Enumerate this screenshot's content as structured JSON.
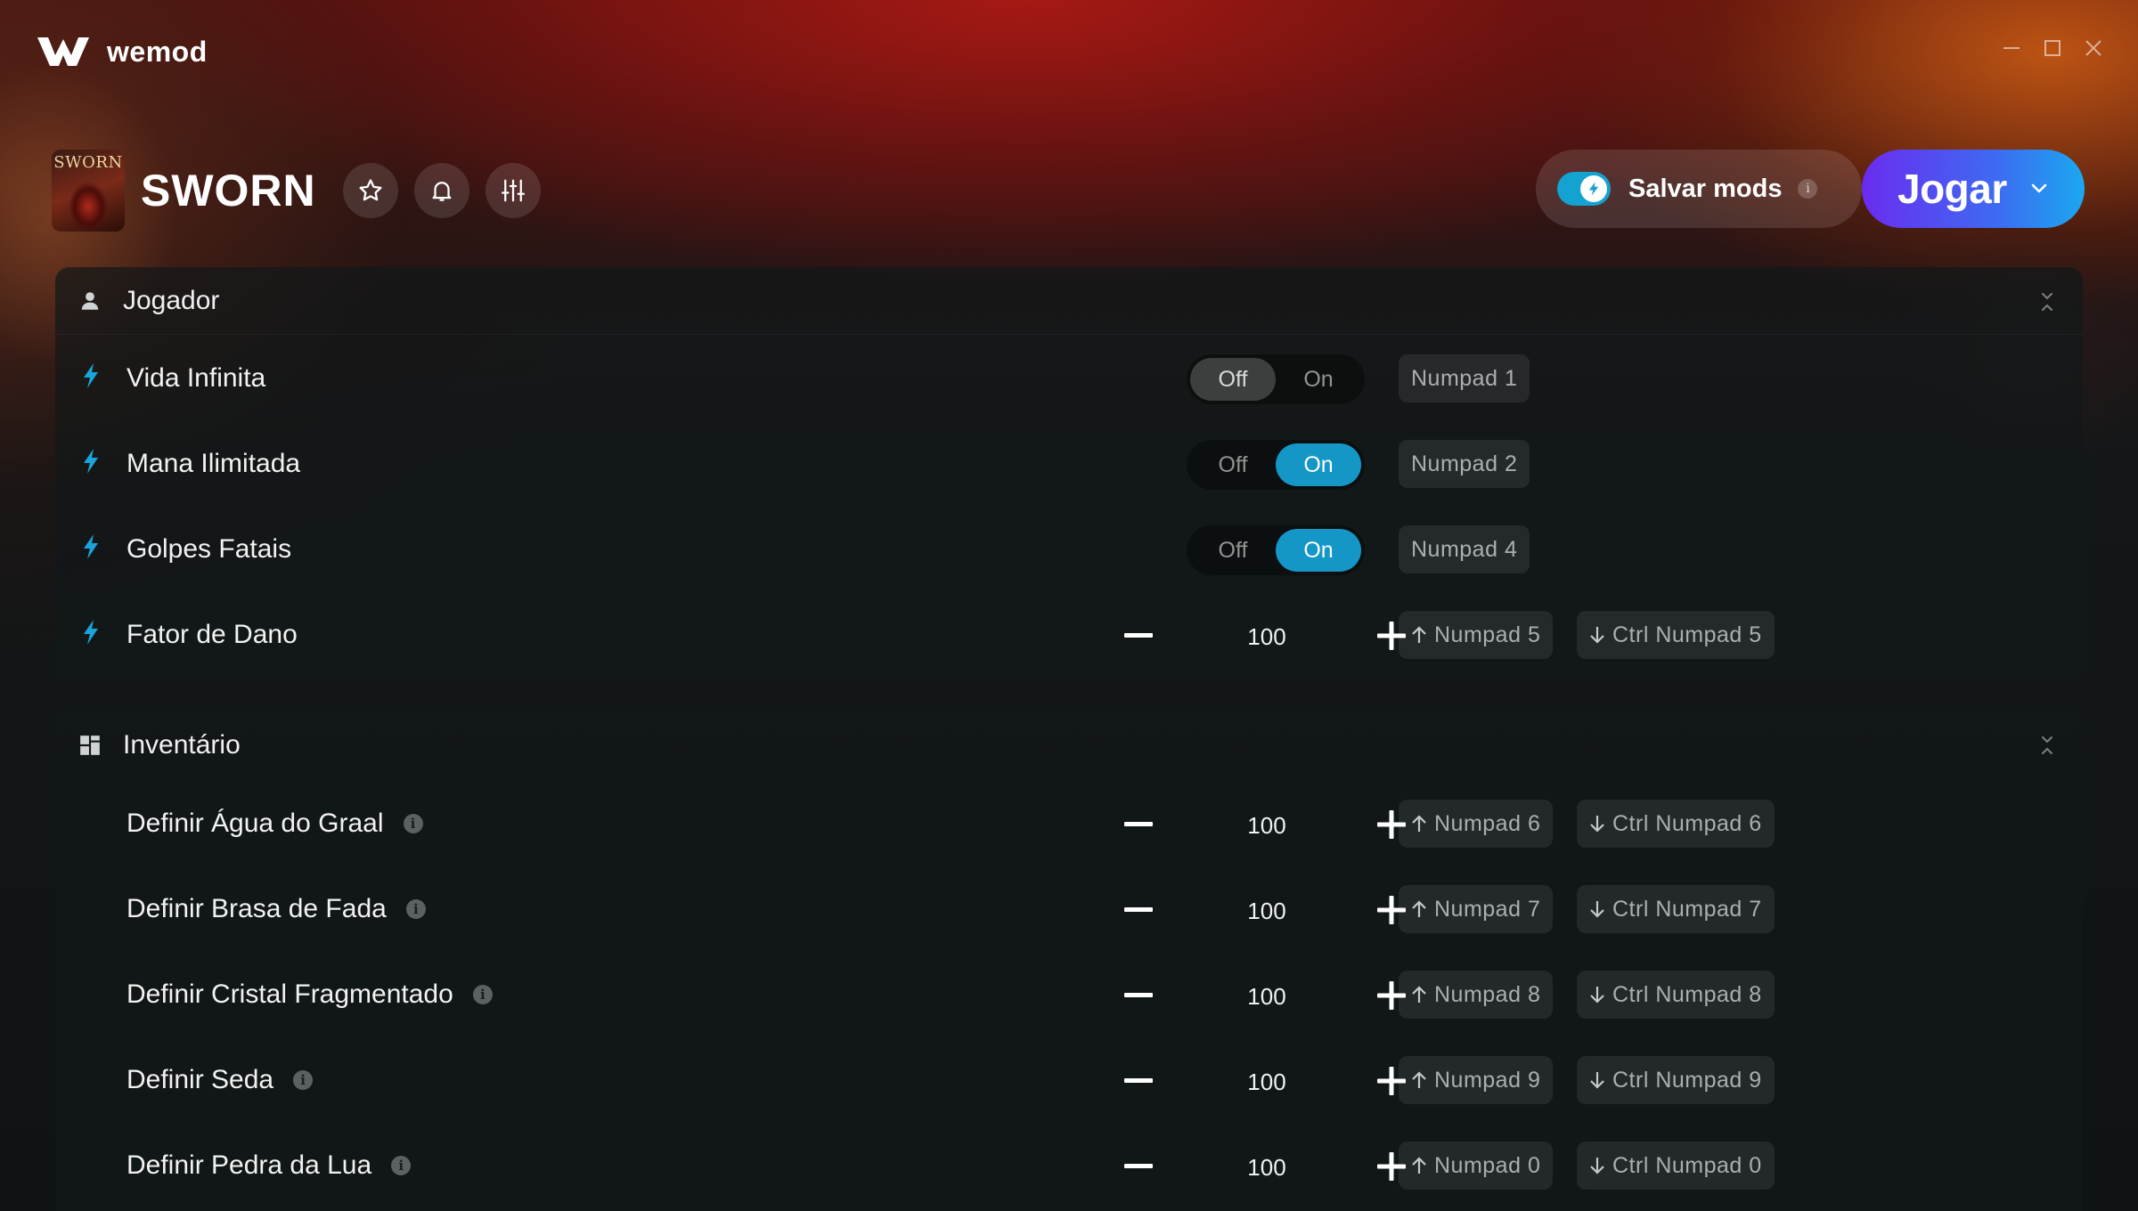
{
  "app": {
    "name": "wemod"
  },
  "game": {
    "title": "SWORN",
    "thumb_text": "SWORN"
  },
  "header": {
    "save_mods": {
      "label": "Salvar mods",
      "info": "i",
      "enabled": true
    },
    "play": {
      "label": "Jogar"
    }
  },
  "colors": {
    "accent": "#1496c7",
    "play_gradient_start": "#6a2cf0",
    "play_gradient_end": "#1aa8f0"
  },
  "sections": [
    {
      "title": "Jogador",
      "icon": "person-icon",
      "rows": [
        {
          "label": "Vida Infinita",
          "type": "toggle",
          "off": "Off",
          "on": "On",
          "state": "off",
          "keys": [
            "Numpad 1"
          ]
        },
        {
          "label": "Mana Ilimitada",
          "type": "toggle",
          "off": "Off",
          "on": "On",
          "state": "on",
          "keys": [
            "Numpad 2"
          ]
        },
        {
          "label": "Golpes Fatais",
          "type": "toggle",
          "off": "Off",
          "on": "On",
          "state": "on",
          "keys": [
            "Numpad 4"
          ]
        },
        {
          "label": "Fator de Dano",
          "type": "stepper",
          "value": "100",
          "keys": [
            "Numpad 5",
            "Ctrl Numpad 5"
          ]
        }
      ]
    },
    {
      "title": "Inventário",
      "icon": "grid-icon",
      "rows": [
        {
          "label": "Definir Água do Graal",
          "info": "i",
          "type": "stepper",
          "value": "100",
          "keys": [
            "Numpad 6",
            "Ctrl Numpad 6"
          ]
        },
        {
          "label": "Definir Brasa de Fada",
          "info": "i",
          "type": "stepper",
          "value": "100",
          "keys": [
            "Numpad 7",
            "Ctrl Numpad 7"
          ]
        },
        {
          "label": "Definir Cristal Fragmentado",
          "info": "i",
          "type": "stepper",
          "value": "100",
          "keys": [
            "Numpad 8",
            "Ctrl Numpad 8"
          ]
        },
        {
          "label": "Definir Seda",
          "info": "i",
          "type": "stepper",
          "value": "100",
          "keys": [
            "Numpad 9",
            "Ctrl Numpad 9"
          ]
        },
        {
          "label": "Definir Pedra da Lua",
          "info": "i",
          "type": "stepper",
          "value": "100",
          "keys": [
            "Numpad 0",
            "Ctrl Numpad 0"
          ]
        }
      ]
    }
  ]
}
